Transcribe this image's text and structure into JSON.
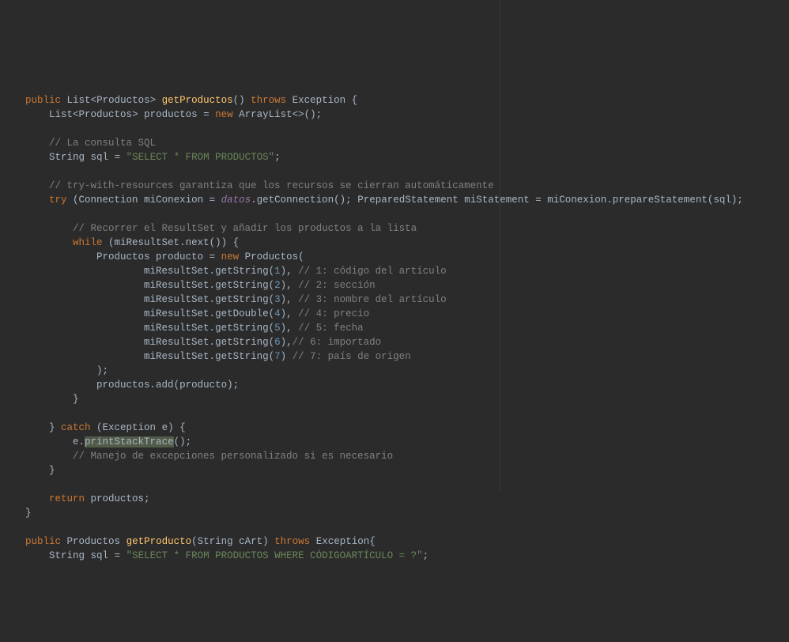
{
  "code": {
    "kw": {
      "public1": "public",
      "public2": "public",
      "new1": "new",
      "new2": "new",
      "throws1": "throws",
      "throws2": "throws",
      "try": "try",
      "while": "while",
      "catch": "catch",
      "return": "return"
    },
    "ident": {
      "List": "List",
      "Productos": "Productos",
      "getProductos": "getProductos",
      "Exception": "Exception",
      "productos_decl": "productos",
      "ArrayList": "ArrayList",
      "String": "String",
      "sql": "sql",
      "Connection": "Connection",
      "miConexion": "miConexion",
      "datos": "datos",
      "getConnection": "getConnection",
      "PreparedStatement": "PreparedStatement",
      "miStatement": "miStatement",
      "prepareStatement": "prepareStatement",
      "miResultSet": "miResultSet",
      "next": "next",
      "producto": "producto",
      "getString": "getString",
      "getDouble": "getDouble",
      "add": "add",
      "e": "e",
      "printStackTrace": "printStackTrace",
      "getProducto": "getProducto",
      "cArt": "cArt"
    },
    "str": {
      "select_all": "\"SELECT * FROM PRODUCTOS\"",
      "select_where": "\"SELECT * FROM PRODUCTOS WHERE CÓDIGOARTÍCULO = ?\""
    },
    "num": {
      "n1": "1",
      "n2": "2",
      "n3": "3",
      "n4": "4",
      "n5": "5",
      "n6": "6",
      "n7": "7"
    },
    "cm": {
      "c_consulta": "// La consulta SQL",
      "c_try": "// try-with-resources garantiza que los recursos se cierran automáticamente",
      "c_recorrer": "// Recorrer el ResultSet y añadir los productos a la lista",
      "c1": "// 1: código del artículo",
      "c2": "// 2: sección",
      "c3": "// 3: nombre del artículo",
      "c4": "// 4: precio",
      "c5": "// 5: fecha",
      "c6": "// 6: importado",
      "c7": "// 7: país de origen",
      "c_manejo": "// Manejo de excepciones personalizado si es necesario"
    }
  }
}
